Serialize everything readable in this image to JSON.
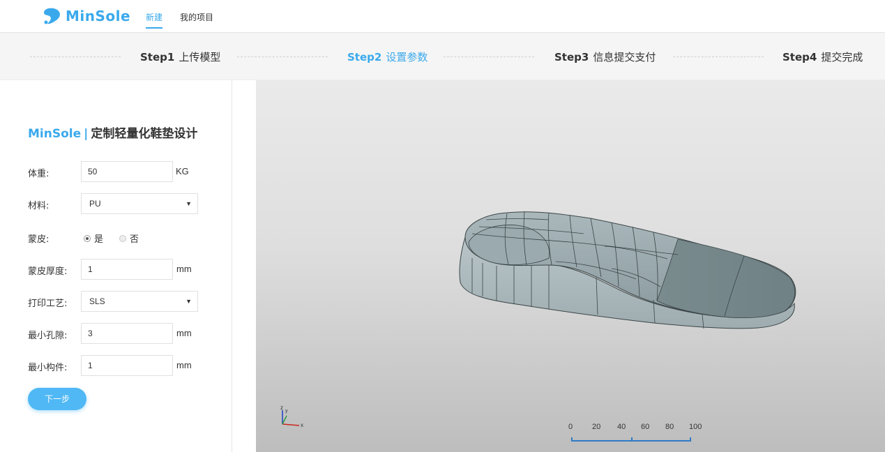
{
  "brand": {
    "name": "MinSole",
    "color": "#3aa9ec"
  },
  "nav": {
    "items": [
      {
        "label": "新建",
        "active": true
      },
      {
        "label": "我的项目",
        "active": false
      }
    ]
  },
  "steps": [
    {
      "num": "Step1",
      "text": "上传模型",
      "current": false
    },
    {
      "num": "Step2",
      "text": "设置参数",
      "current": true
    },
    {
      "num": "Step3",
      "text": "信息提交支付",
      "current": false
    },
    {
      "num": "Step4",
      "text": "提交完成",
      "current": false
    }
  ],
  "form": {
    "title_brand": "MinSole",
    "title_sep": "|",
    "title_text": "定制轻量化鞋垫设计",
    "weight": {
      "label": "体重:",
      "value": "50",
      "unit": "KG"
    },
    "material": {
      "label": "材料:",
      "value": "PU"
    },
    "skin": {
      "label": "蒙皮:",
      "yes": "是",
      "no": "否",
      "selected": "是"
    },
    "skin_thickness": {
      "label": "蒙皮厚度:",
      "value": "1",
      "unit": "mm"
    },
    "process": {
      "label": "打印工艺:",
      "value": "SLS"
    },
    "min_pore": {
      "label": "最小孔隙:",
      "value": "3",
      "unit": "mm"
    },
    "min_member": {
      "label": "最小构件:",
      "value": "1",
      "unit": "mm"
    },
    "next_label": "下一步"
  },
  "viewer": {
    "axes": {
      "x": "x",
      "y": "y",
      "z": "z"
    },
    "scale_ticks": [
      "0",
      "20",
      "40",
      "60",
      "80",
      "100"
    ],
    "model_color": "#8e9ea3",
    "scale_color": "#2f7bc4"
  }
}
